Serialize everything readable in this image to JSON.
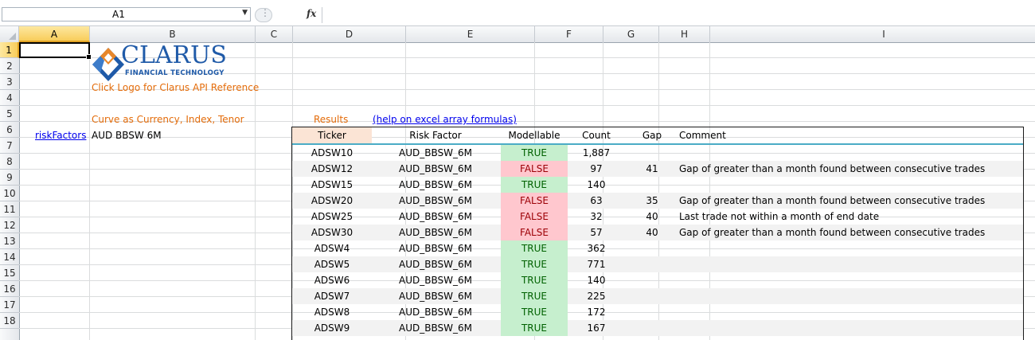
{
  "formula_bar": {
    "name_box": "A1",
    "fx_label": "fx",
    "formula": ""
  },
  "columns": [
    {
      "letter": "A",
      "active": true
    },
    {
      "letter": "B",
      "active": false
    },
    {
      "letter": "C",
      "active": false
    },
    {
      "letter": "D",
      "active": false
    },
    {
      "letter": "E",
      "active": false
    },
    {
      "letter": "F",
      "active": false
    },
    {
      "letter": "G",
      "active": false
    },
    {
      "letter": "H",
      "active": false
    },
    {
      "letter": "I",
      "active": false
    }
  ],
  "rows": [
    "1",
    "2",
    "3",
    "4",
    "5",
    "6",
    "7",
    "8",
    "9",
    "10",
    "11",
    "12",
    "13",
    "14",
    "15",
    "16",
    "17",
    "18"
  ],
  "logo": {
    "word": "CLARUS",
    "tagline": "FINANCIAL TECHNOLOGY",
    "brand_color": "#1f5aa8",
    "accent_color": "#e8872a"
  },
  "cells": {
    "logo_hint": "Click Logo for Clarus API Reference",
    "curve_label": "Curve as Currency, Index, Tenor",
    "risk_factors_link": "riskFactors",
    "risk_factors_value": "AUD BBSW 6M",
    "results_label": "Results",
    "help_link": "(help on excel array formulas)"
  },
  "results_table": {
    "headers": [
      "Ticker",
      "Risk Factor",
      "Modellable",
      "Count",
      "Gap",
      "Comment"
    ],
    "rows": [
      {
        "ticker": "ADSW10",
        "risk": "AUD_BBSW_6M",
        "mod": "TRUE",
        "count": "1,887",
        "gap": "",
        "comment": ""
      },
      {
        "ticker": "ADSW12",
        "risk": "AUD_BBSW_6M",
        "mod": "FALSE",
        "count": "97",
        "gap": "41",
        "comment": "Gap of greater than a month found between consecutive trades"
      },
      {
        "ticker": "ADSW15",
        "risk": "AUD_BBSW_6M",
        "mod": "TRUE",
        "count": "140",
        "gap": "",
        "comment": ""
      },
      {
        "ticker": "ADSW20",
        "risk": "AUD_BBSW_6M",
        "mod": "FALSE",
        "count": "63",
        "gap": "35",
        "comment": "Gap of greater than a month found between consecutive trades"
      },
      {
        "ticker": "ADSW25",
        "risk": "AUD_BBSW_6M",
        "mod": "FALSE",
        "count": "32",
        "gap": "40",
        "comment": "Last trade not within a month of end date"
      },
      {
        "ticker": "ADSW30",
        "risk": "AUD_BBSW_6M",
        "mod": "FALSE",
        "count": "57",
        "gap": "40",
        "comment": "Gap of greater than a month found between consecutive trades"
      },
      {
        "ticker": "ADSW4",
        "risk": "AUD_BBSW_6M",
        "mod": "TRUE",
        "count": "362",
        "gap": "",
        "comment": ""
      },
      {
        "ticker": "ADSW5",
        "risk": "AUD_BBSW_6M",
        "mod": "TRUE",
        "count": "771",
        "gap": "",
        "comment": ""
      },
      {
        "ticker": "ADSW6",
        "risk": "AUD_BBSW_6M",
        "mod": "TRUE",
        "count": "140",
        "gap": "",
        "comment": ""
      },
      {
        "ticker": "ADSW7",
        "risk": "AUD_BBSW_6M",
        "mod": "TRUE",
        "count": "225",
        "gap": "",
        "comment": ""
      },
      {
        "ticker": "ADSW8",
        "risk": "AUD_BBSW_6M",
        "mod": "TRUE",
        "count": "172",
        "gap": "",
        "comment": ""
      },
      {
        "ticker": "ADSW9",
        "risk": "AUD_BBSW_6M",
        "mod": "TRUE",
        "count": "167",
        "gap": "",
        "comment": ""
      }
    ]
  },
  "colors": {
    "true_fill": "#c6efce",
    "true_text": "#006100",
    "false_fill": "#ffc7ce",
    "false_text": "#9c0006",
    "label_orange": "#e46c0a",
    "link_blue": "#0000ee",
    "header_accent": "#4bacc6"
  }
}
